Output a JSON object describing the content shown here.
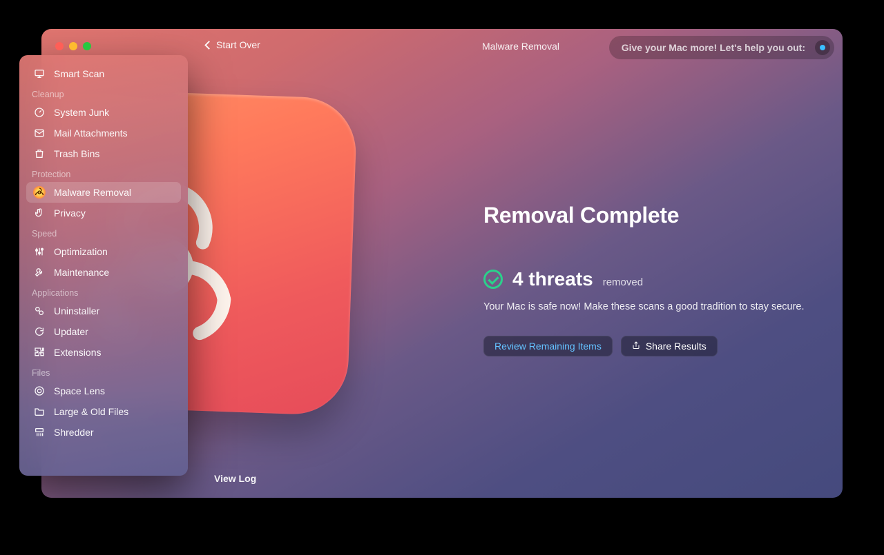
{
  "header": {
    "start_over": "Start Over",
    "breadcrumb": "Malware Removal",
    "promo": "Give your Mac more! Let's help you out:"
  },
  "results": {
    "title": "Removal Complete",
    "threat_count": "4 threats",
    "threat_suffix": "removed",
    "safe_msg": "Your Mac is safe now! Make these scans a good tradition to stay secure.",
    "review_btn": "Review Remaining Items",
    "share_btn": "Share Results"
  },
  "footer": {
    "view_log": "View Log"
  },
  "sidebar": {
    "smart_scan": "Smart Scan",
    "groups": {
      "cleanup": {
        "label": "Cleanup",
        "items": [
          "System Junk",
          "Mail Attachments",
          "Trash Bins"
        ]
      },
      "protection": {
        "label": "Protection",
        "items": [
          "Malware Removal",
          "Privacy"
        ]
      },
      "speed": {
        "label": "Speed",
        "items": [
          "Optimization",
          "Maintenance"
        ]
      },
      "applications": {
        "label": "Applications",
        "items": [
          "Uninstaller",
          "Updater",
          "Extensions"
        ]
      },
      "files": {
        "label": "Files",
        "items": [
          "Space Lens",
          "Large & Old Files",
          "Shredder"
        ]
      }
    }
  }
}
